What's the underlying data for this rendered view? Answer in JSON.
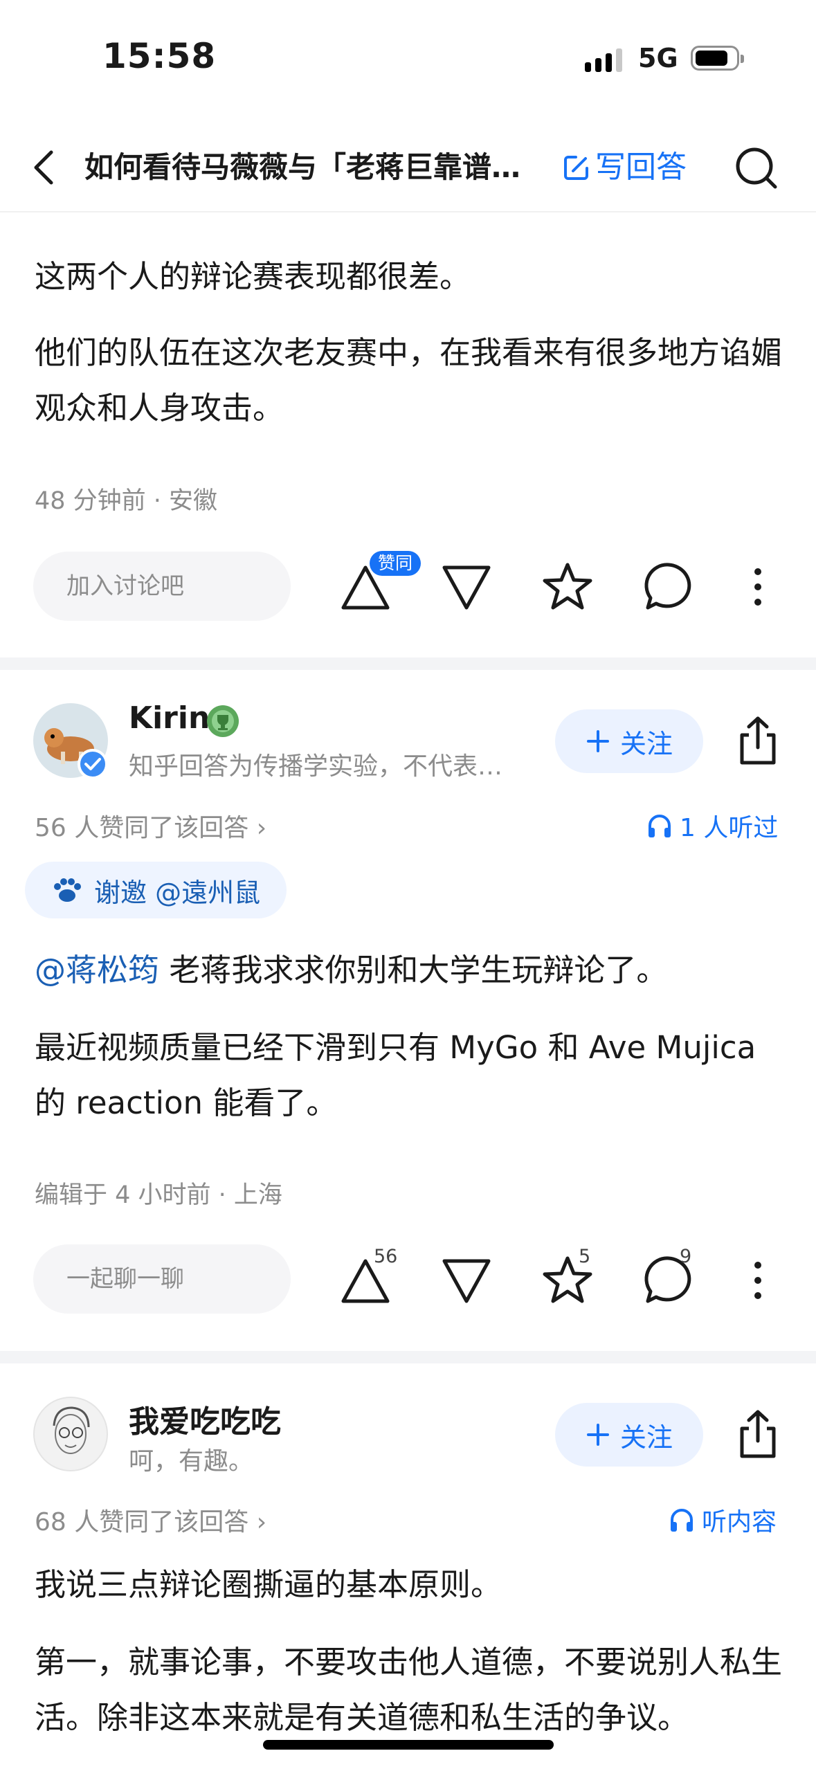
{
  "status_bar": {
    "time": "15:58",
    "network": "5G"
  },
  "nav": {
    "title": "如何看待马薇薇与「老蒋巨靠谱…",
    "write_answer": "写回答"
  },
  "answer1": {
    "paragraphs": [
      "这两个人的辩论赛表现都很差。",
      "他们的队伍在这次老友赛中，在我看来有很多地方谄媚观众和人身攻击。"
    ],
    "meta": "48 分钟前 · 安徽",
    "comment_placeholder": "加入讨论吧",
    "upvote_badge": "赞同"
  },
  "answer2": {
    "author": "Kirin",
    "bio": "知乎回答为传播学实验，不代表…",
    "follow_label": "关注",
    "upvote_summary": "56 人赞同了该回答 ›",
    "listen_label": "1 人听过",
    "invite_label": "谢邀 @遠州鼠",
    "mention": "@蒋松筠",
    "line1_text": " 老蒋我求求你别和大学生玩辩论了。",
    "paragraph2": "最近视频质量已经下滑到只有 MyGo 和 Ave Mujica 的 reaction 能看了。",
    "meta": "编辑于 4 小时前 · 上海",
    "comment_placeholder": "一起聊一聊",
    "upvote_count": "56",
    "favorite_count": "5",
    "comment_count": "9"
  },
  "answer3": {
    "author": "我爱吃吃吃",
    "bio": "呵，有趣。",
    "follow_label": "关注",
    "upvote_summary": "68 人赞同了该回答 ›",
    "listen_label": "听内容",
    "paragraphs": [
      "我说三点辩论圈撕逼的基本原则。",
      "第一，就事论事，不要攻击他人道德，不要说别人私生活。除非这本来就是有关道德和私生活的争议。"
    ]
  },
  "colors": {
    "accent": "#1772f6",
    "mention": "#1a5fb4",
    "muted": "#8c8c8c"
  }
}
